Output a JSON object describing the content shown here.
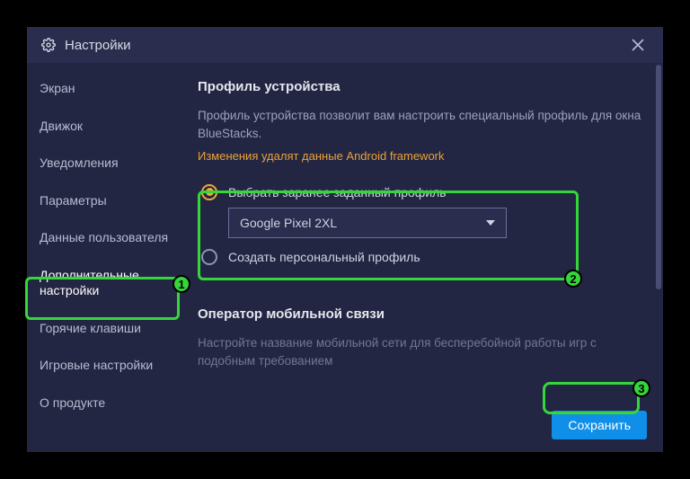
{
  "window": {
    "title": "Настройки"
  },
  "sidebar": {
    "items": [
      {
        "label": "Экран"
      },
      {
        "label": "Движок"
      },
      {
        "label": "Уведомления"
      },
      {
        "label": "Параметры"
      },
      {
        "label": "Данные пользователя"
      },
      {
        "label": "Дополнительные настройки"
      },
      {
        "label": "Горячие клавиши"
      },
      {
        "label": "Игровые настройки"
      },
      {
        "label": "О продукте"
      }
    ],
    "active_index": 5
  },
  "profile": {
    "title": "Профиль устройства",
    "description": "Профиль устройства позволит вам настроить специальный профиль для окна BlueStacks.",
    "warning": "Изменения удалят данные Android framework",
    "option_preset": "Выбрать заранее заданный профиль",
    "option_custom": "Создать персональный профиль",
    "selected_preset": "Google Pixel 2XL",
    "selected_option": "preset"
  },
  "carrier": {
    "title": "Оператор мобильной связи",
    "description": "Настройте название мобильной сети для бесперебойной работы игр с подобным требованием"
  },
  "footer": {
    "save_label": "Сохранить"
  },
  "annotations": {
    "n1": "1",
    "n2": "2",
    "n3": "3"
  }
}
